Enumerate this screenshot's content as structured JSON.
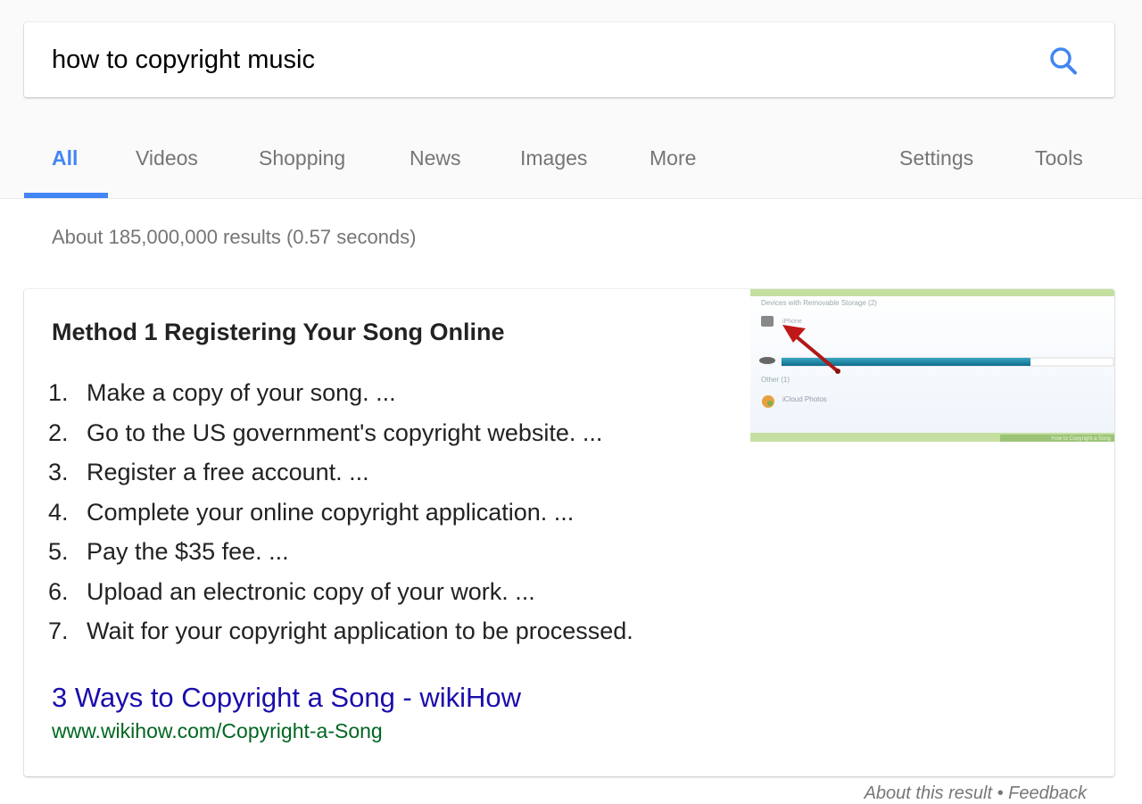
{
  "search": {
    "query": "how to copyright music",
    "icon": "search-icon",
    "accent_color": "#4285f4"
  },
  "tabs": {
    "items": [
      {
        "label": "All",
        "active": true
      },
      {
        "label": "Videos",
        "active": false
      },
      {
        "label": "Shopping",
        "active": false
      },
      {
        "label": "News",
        "active": false
      },
      {
        "label": "Images",
        "active": false
      },
      {
        "label": "More",
        "active": false
      }
    ],
    "settings": "Settings",
    "tools": "Tools"
  },
  "result_stats": "About 185,000,000 results (0.57 seconds)",
  "featured_snippet": {
    "title": "Method 1 Registering Your Song Online",
    "steps": [
      {
        "num": "1.",
        "text": "Make a copy of your song. ..."
      },
      {
        "num": "2.",
        "text": "Go to the US government's copyright website. ..."
      },
      {
        "num": "3.",
        "text": "Register a free account. ..."
      },
      {
        "num": "4.",
        "text": "Complete your online copyright application. ..."
      },
      {
        "num": "5.",
        "text": "Pay the $35 fee. ..."
      },
      {
        "num": "6.",
        "text": "Upload an electronic copy of your work. ..."
      },
      {
        "num": "7.",
        "text": "Wait for your copyright application to be processed."
      }
    ],
    "source_title": "3 Ways to Copyright a Song - wikiHow",
    "source_url": "www.wikihow.com/Copyright-a-Song",
    "thumbnail": {
      "section1": "Devices with Removable Storage (2)",
      "device_label": "iPhone",
      "section2": "Other (1)",
      "other_label": "iCloud Photos",
      "watermark": "How to Copyright a Song",
      "storage_fill": 0.75
    }
  },
  "footer": {
    "about": "About this result",
    "separator": "•",
    "feedback": "Feedback"
  }
}
